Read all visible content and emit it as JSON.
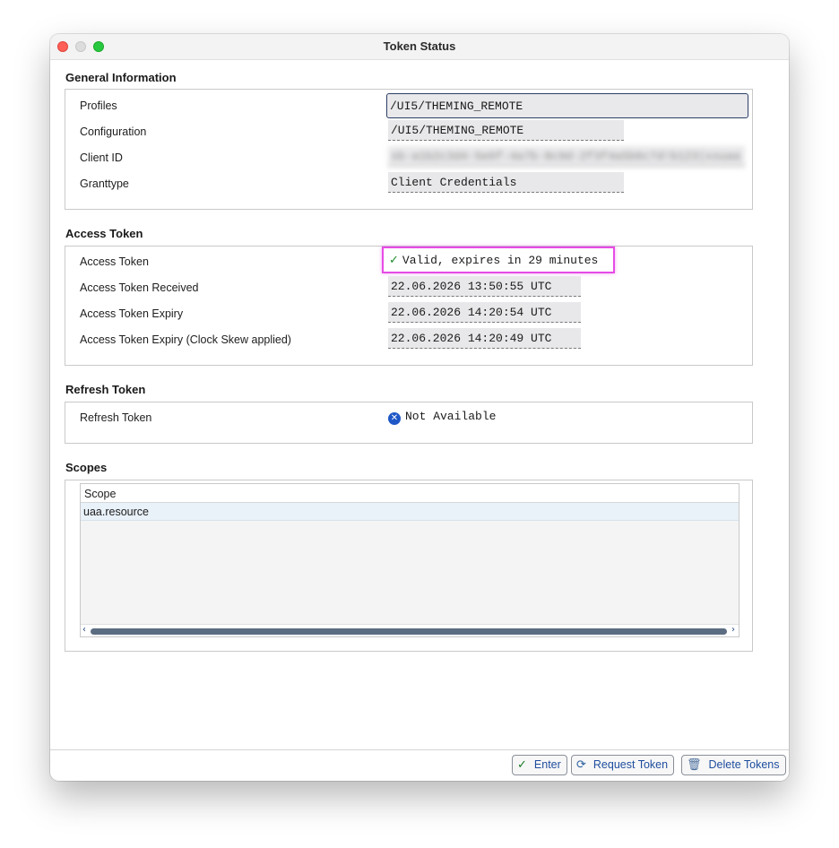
{
  "window": {
    "title": "Token Status"
  },
  "general": {
    "title": "General Information",
    "profiles_label": "Profiles",
    "profiles_value": "/UI5/THEMING_REMOTE",
    "configuration_label": "Configuration",
    "configuration_value": "/UI5/THEMING_REMOTE",
    "client_id_label": "Client ID",
    "client_id_value": "sb-a1b2c3d4-5e6f-4a7b-8c9d-2f3f4a5b6c7d!b123|xsuaa",
    "granttype_label": "Granttype",
    "granttype_value": "Client Credentials"
  },
  "access": {
    "title": "Access Token",
    "token_label": "Access Token",
    "token_status": "Valid, expires in 29 minutes",
    "received_label": "Access Token Received",
    "received_value": "22.06.2026 13:50:55 UTC",
    "expiry_label": "Access Token Expiry",
    "expiry_value": "22.06.2026 14:20:54 UTC",
    "skew_label": "Access Token Expiry (Clock Skew applied)",
    "skew_value": "22.06.2026 14:20:49 UTC"
  },
  "refresh": {
    "title": "Refresh Token",
    "label": "Refresh Token",
    "status": "Not Available"
  },
  "scopes": {
    "title": "Scopes",
    "column": "Scope",
    "rows": [
      "uaa.resource"
    ]
  },
  "footer": {
    "enter": "Enter",
    "request": "Request Token",
    "delete": "Delete Tokens"
  }
}
